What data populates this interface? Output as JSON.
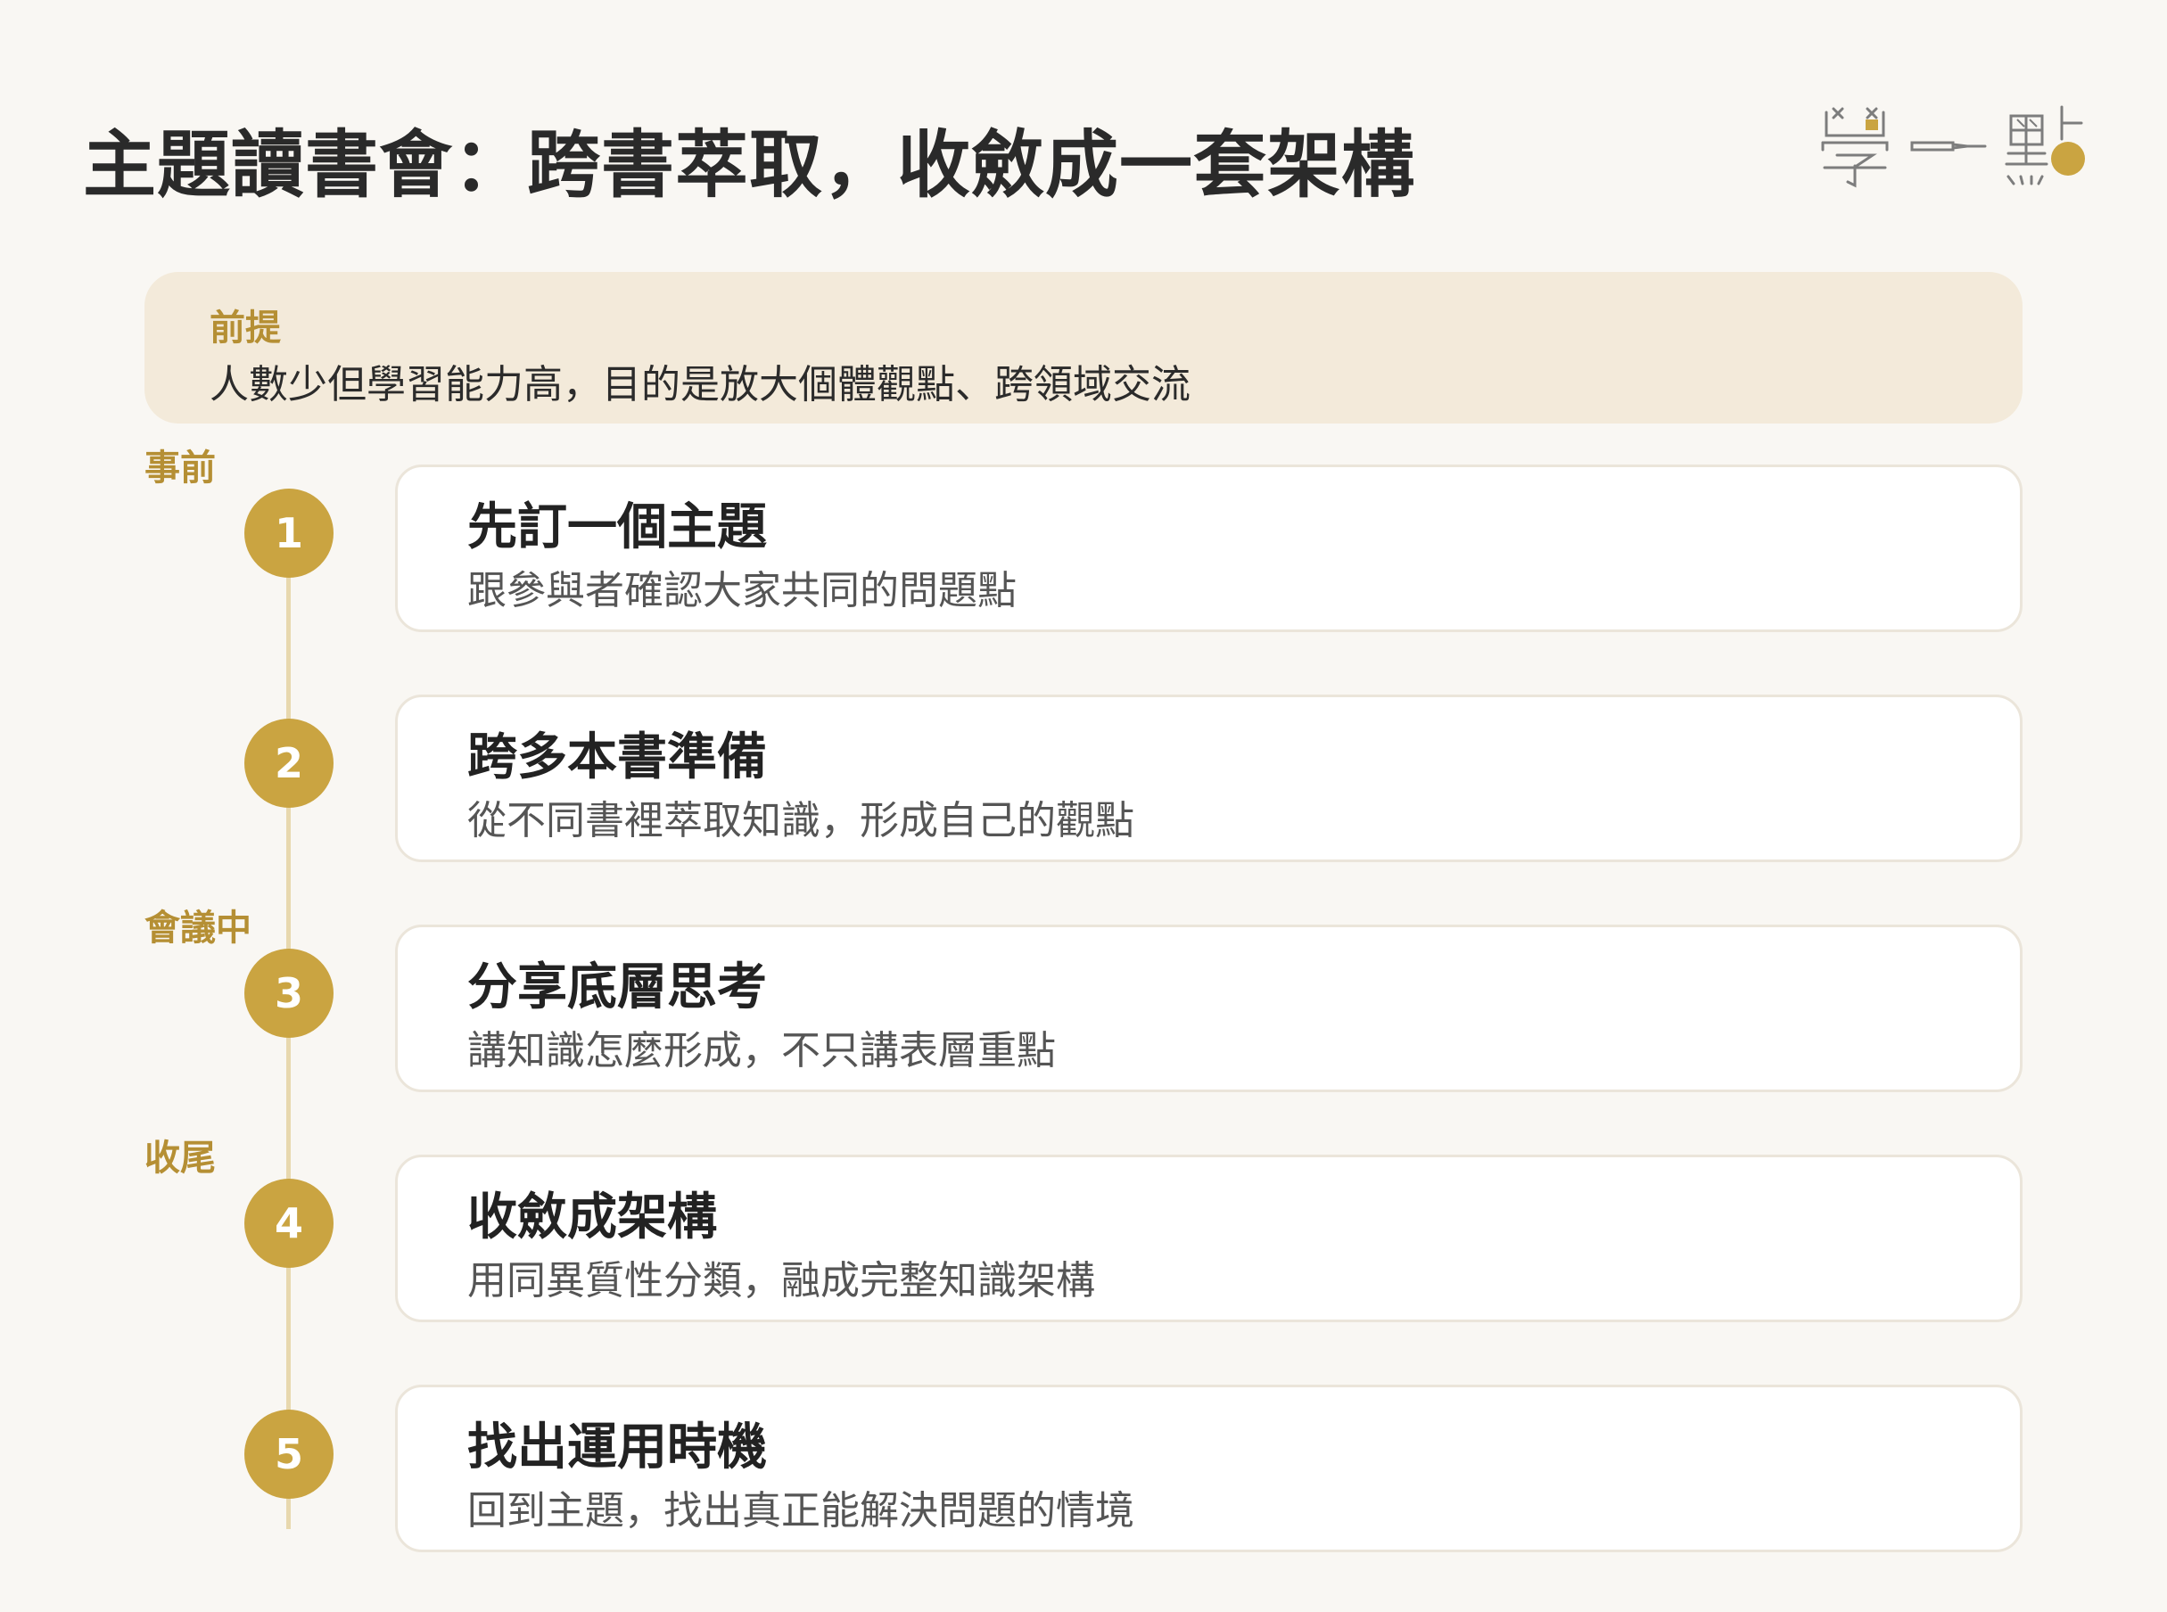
{
  "title": "主題讀書會：跨書萃取，收斂成一套架構",
  "logo": {
    "icon": "學一點 logo"
  },
  "premise": {
    "label": "前提",
    "text": "人數少但學習能力高，目的是放大個體觀點、跨領域交流"
  },
  "phases": [
    {
      "label": "事前"
    },
    {
      "label": "會議中"
    },
    {
      "label": "收尾"
    }
  ],
  "steps": [
    {
      "number": "1",
      "title": "先訂一個主題",
      "desc": "跟參與者確認大家共同的問題點"
    },
    {
      "number": "2",
      "title": "跨多本書準備",
      "desc": "從不同書裡萃取知識，形成自己的觀點"
    },
    {
      "number": "3",
      "title": "分享底層思考",
      "desc": "講知識怎麼形成，不只講表層重點"
    },
    {
      "number": "4",
      "title": "收斂成架構",
      "desc": "用同異質性分類，融成完整知識架構"
    },
    {
      "number": "5",
      "title": "找出運用時機",
      "desc": "回到主題，找出真正能解決問題的情境"
    }
  ],
  "colors": {
    "accent": "#caa441",
    "accent_text": "#b58f34",
    "premise_bg": "#f3eada",
    "background": "#f9f7f3"
  }
}
